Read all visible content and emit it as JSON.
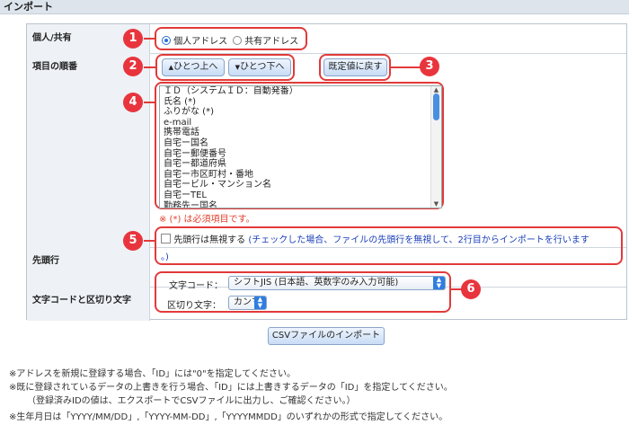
{
  "section": {
    "title": "インポート"
  },
  "rows": {
    "account_type": {
      "label": "個人/共有",
      "option_personal": "個人アドレス",
      "option_shared": "共有アドレス",
      "selected": "個人アドレス"
    },
    "item_order": {
      "label": "項目の順番",
      "move_up": "ひとつ上へ",
      "move_down": "ひとつ下へ",
      "reset": "既定値に戻す",
      "items": [
        "ＩＤ（システムＩＤ：自動発番）",
        "氏名 (*)",
        "ふりがな (*)",
        "e-mail",
        "携帯電話",
        "自宅ー国名",
        "自宅ー郵便番号",
        "自宅ー都道府県",
        "自宅ー市区町村・番地",
        "自宅ービル・マンション名",
        "自宅ーTEL",
        "勤務先ー国名"
      ],
      "required_note": "※ (*) は必須項目です。"
    },
    "header_row": {
      "label": "先頭行",
      "checkbox_label": "先頭行は無視する",
      "hint": "(チェックした場合、ファイルの先頭行を無視して、2行目からインポートを行います",
      "hint_end": "。)"
    },
    "encoding": {
      "label": "文字コードと区切り文字",
      "charset_label": "文字コード：",
      "charset_value": "シフトJIS (日本語、英数字のみ入力可能)",
      "delimiter_label": "区切り文字：",
      "delimiter_value": "カンマ"
    }
  },
  "import_button": "CSVファイルのインポート",
  "notes": [
    "※アドレスを新規に登録する場合、「ID」には\"0\"を指定してください。",
    "※既に登録されているデータの上書きを行う場合、「ID」には上書きするデータの「ID」を指定してください。",
    "（登録済みIDの値は、エクスポートでCSVファイルに出力し、ご確認ください。）",
    "※生年月日は「YYYY/MM/DD」,「YYYY-MM-DD」,「YYYYMMDD」のいずれかの形式で指定してください。"
  ],
  "callouts": [
    "1",
    "2",
    "3",
    "4",
    "5",
    "6"
  ],
  "colors": {
    "accent": "#e8353d",
    "header_bg": "#dde4ec",
    "label_bg": "#eef2f6",
    "link_blue": "#1a3fb8"
  }
}
